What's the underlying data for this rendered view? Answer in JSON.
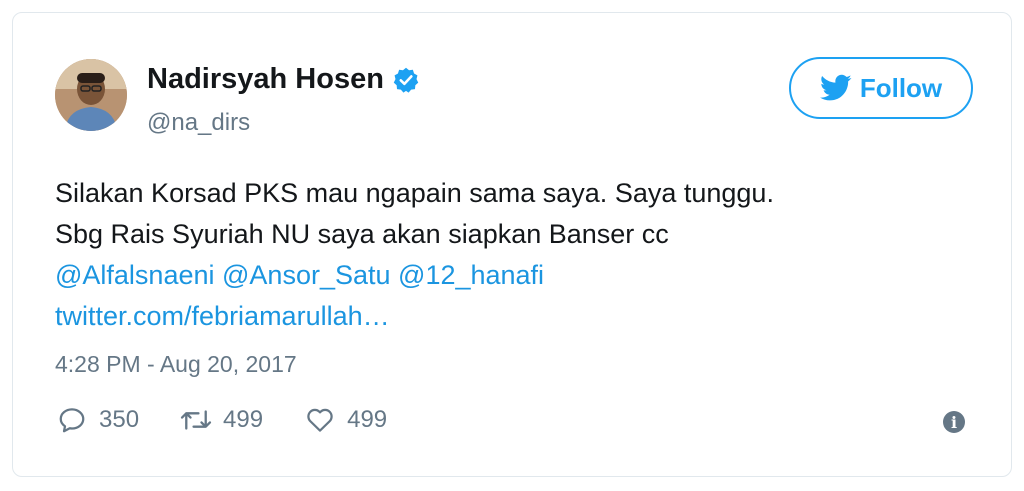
{
  "tweet": {
    "display_name": "Nadirsyah Hosen",
    "handle": "@na_dirs",
    "follow_label": "Follow",
    "lines": [
      "Silakan Korsad PKS mau ngapain sama saya. Saya tunggu.",
      "Sbg Rais Syuriah NU saya akan siapkan Banser cc"
    ],
    "mentions": [
      "@Alfalsnaeni",
      "@Ansor_Satu",
      "@12_hanafi"
    ],
    "link": "twitter.com/febriamarullah…",
    "timestamp": "4:28 PM - Aug 20, 2017",
    "stats": {
      "replies": "350",
      "retweets": "499",
      "likes": "499"
    }
  },
  "colors": {
    "accent": "#1da1f2",
    "link": "#1b95e0",
    "muted": "#657786",
    "text": "#14171a"
  },
  "icons": [
    "verified-badge-icon",
    "twitter-bird-icon",
    "reply-icon",
    "retweet-icon",
    "like-heart-icon",
    "info-icon"
  ]
}
